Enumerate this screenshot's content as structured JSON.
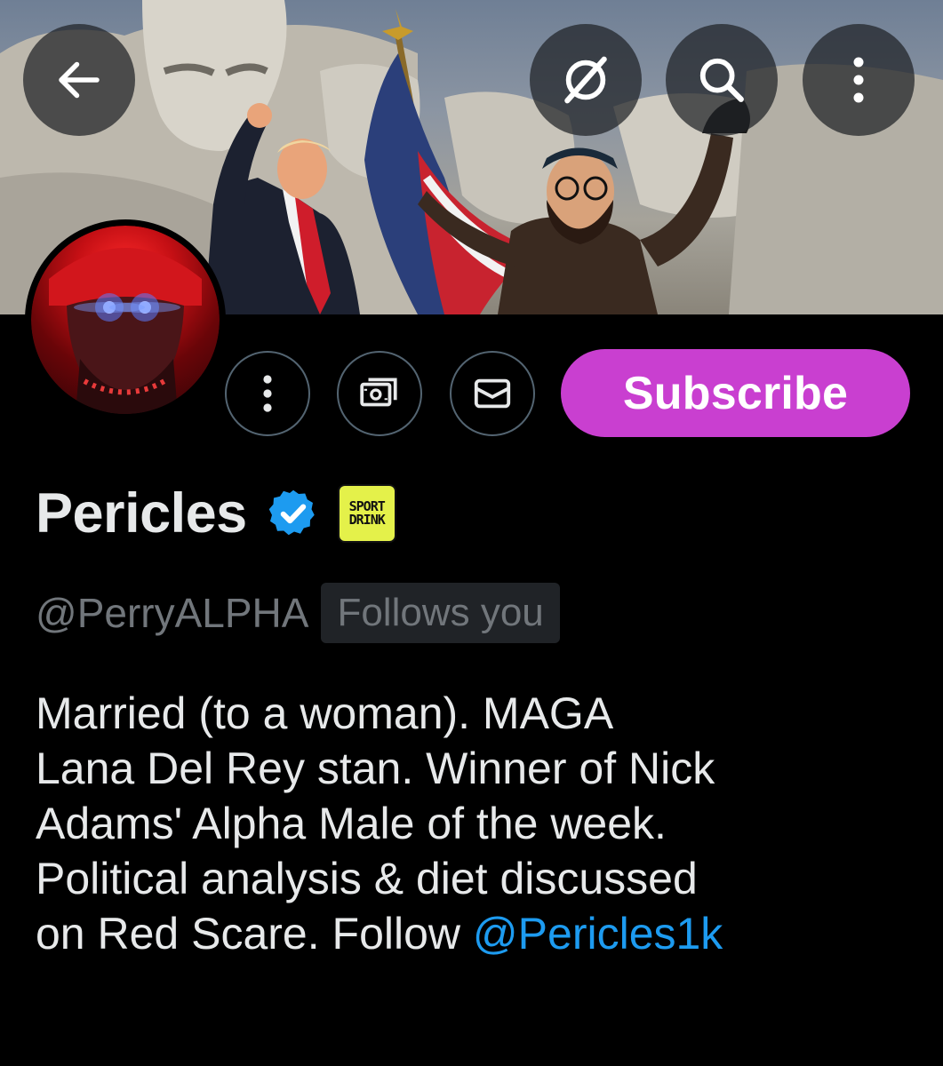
{
  "header": {
    "back_icon": "arrow-left-icon",
    "grok_icon": "grok-icon",
    "search_icon": "search-icon",
    "more_icon": "more-vertical-icon"
  },
  "actions": {
    "more_icon": "more-vertical-icon",
    "tip_icon": "money-icon",
    "message_icon": "mail-icon",
    "subscribe_label": "Subscribe"
  },
  "profile": {
    "display_name": "Pericles",
    "verified_icon": "verified-badge-icon",
    "affiliate_badge_lines": [
      "SPORT",
      "DRINK"
    ],
    "handle": "@PerryALPHA",
    "follows_you": "Follows you",
    "bio_lines": [
      "Married (to a woman). MAGA",
      "Lana Del Rey stan. Winner of Nick",
      "Adams' Alpha Male of the week.",
      "Political analysis & diet discussed"
    ],
    "bio_last_prefix": "on Red Scare. Follow ",
    "bio_mention": "@Pericles1k"
  },
  "colors": {
    "subscribe_bg": "#c93fd0",
    "mention": "#1d9bf0",
    "verified": "#1d9bf0",
    "muted": "#71767b",
    "affiliate_bg": "#e4f14a"
  }
}
